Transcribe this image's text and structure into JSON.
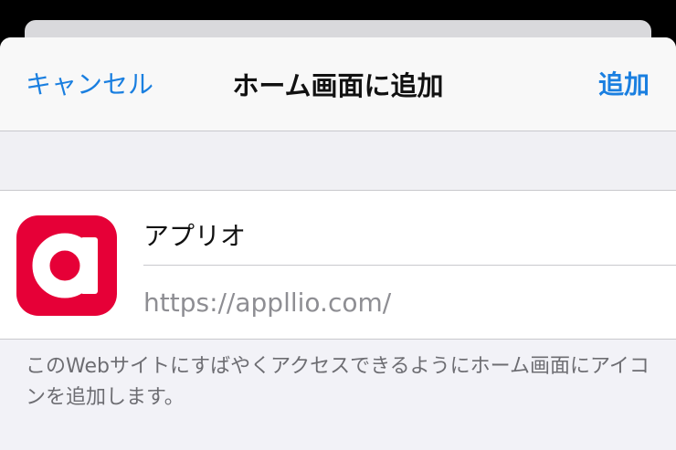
{
  "nav": {
    "cancel_label": "キャンセル",
    "title": "ホーム画面に追加",
    "add_label": "追加"
  },
  "app": {
    "name": "アプリオ",
    "url": "https://appllio.com/",
    "icon_name": "appllio-a-logo-icon",
    "icon_color": "#e60037"
  },
  "footer": {
    "note": "このWebサイトにすばやくアクセスできるようにホーム画面にアイコンを追加します。"
  },
  "colors": {
    "accent": "#1a7fe0",
    "sheet_background": "#f2f2f7"
  }
}
